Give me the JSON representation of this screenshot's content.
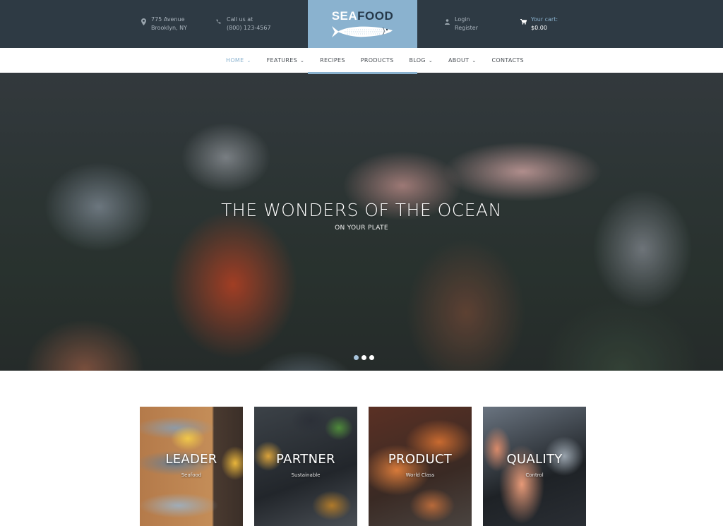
{
  "header": {
    "address": {
      "icon": "map-pin-icon",
      "line1": "775 Avenue",
      "line2": "Brooklyn, NY"
    },
    "phone": {
      "icon": "phone-icon",
      "line1": "Call us at",
      "line2": "(800) 123-4567"
    },
    "logo": {
      "part1": "SEA",
      "part2": "FOOD"
    },
    "account": {
      "icon": "user-icon",
      "login": "Login",
      "register": "Register"
    },
    "cart": {
      "icon": "cart-icon",
      "label": "Your cart:",
      "total": "$0.00"
    },
    "colors": {
      "bar": "#2e3a44",
      "accent": "#8ab2cf"
    }
  },
  "nav": {
    "items": [
      {
        "label": "HOME",
        "dropdown": true,
        "active": true
      },
      {
        "label": "FEATURES",
        "dropdown": true,
        "active": false
      },
      {
        "label": "RECIPES",
        "dropdown": false,
        "active": false
      },
      {
        "label": "PRODUCTS",
        "dropdown": false,
        "active": false
      },
      {
        "label": "BLOG",
        "dropdown": true,
        "active": false
      },
      {
        "label": "ABOUT",
        "dropdown": true,
        "active": false
      },
      {
        "label": "CONTACTS",
        "dropdown": false,
        "active": false
      }
    ],
    "chevron": "⌄"
  },
  "hero": {
    "title": "THE WONDERS OF THE OCEAN",
    "subtitle": "ON YOUR PLATE",
    "slides_total": 3,
    "active_slide": 1
  },
  "cards": [
    {
      "title": "LEADER",
      "subtitle": "Seafood"
    },
    {
      "title": "PARTNER",
      "subtitle": "Sustainable"
    },
    {
      "title": "PRODUCT",
      "subtitle": "World Class"
    },
    {
      "title": "QUALITY",
      "subtitle": "Control"
    }
  ]
}
